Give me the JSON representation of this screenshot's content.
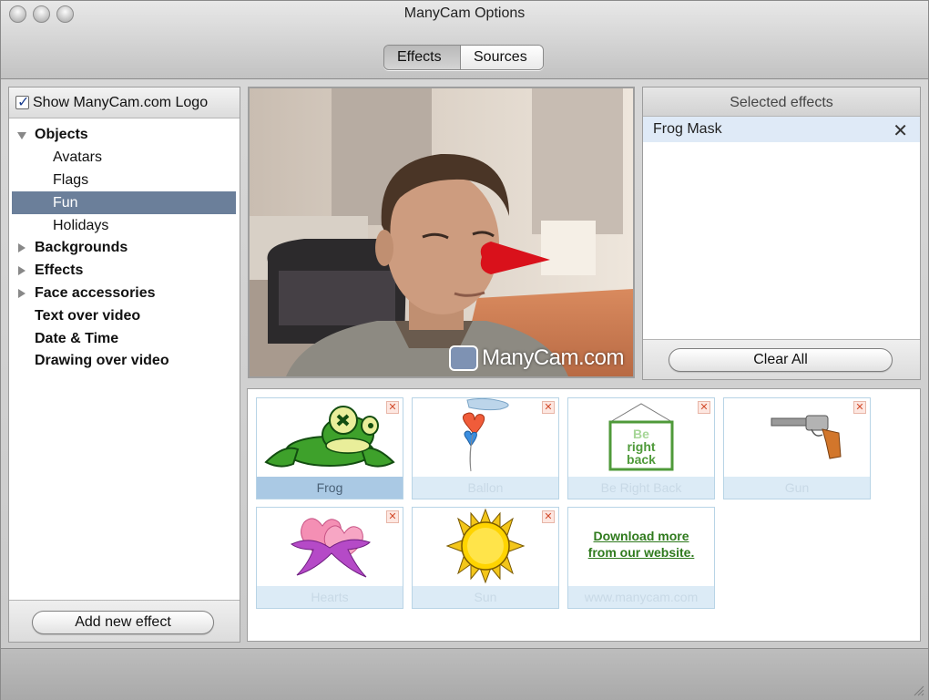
{
  "window": {
    "title": "ManyCam Options"
  },
  "tabs": [
    {
      "label": "Effects"
    },
    {
      "label": "Sources"
    }
  ],
  "left_panel": {
    "show_logo_label": "Show ManyCam.com Logo",
    "show_logo_checked": true,
    "tree": [
      {
        "label": "Objects",
        "level": 0,
        "expanded": true
      },
      {
        "label": "Avatars",
        "level": 1
      },
      {
        "label": "Flags",
        "level": 1
      },
      {
        "label": "Fun",
        "level": 1,
        "selected": true
      },
      {
        "label": "Holidays",
        "level": 1
      },
      {
        "label": "Backgrounds",
        "level": 0,
        "expanded": false
      },
      {
        "label": "Effects",
        "level": 0,
        "expanded": false
      },
      {
        "label": "Face accessories",
        "level": 0,
        "expanded": false
      },
      {
        "label": "Text over video",
        "level": 0
      },
      {
        "label": "Date & Time",
        "level": 0
      },
      {
        "label": "Drawing over video",
        "level": 0
      }
    ],
    "add_button": "Add new effect"
  },
  "preview": {
    "watermark": "ManyCam.com"
  },
  "selected_effects": {
    "header": "Selected effects",
    "items": [
      {
        "label": "Frog Mask"
      }
    ],
    "clear_button": "Clear All"
  },
  "effects_grid": {
    "tiles": [
      {
        "caption": "Frog",
        "icon": "frog-icon",
        "active": true
      },
      {
        "caption": "Ballon",
        "icon": "balloon-icon"
      },
      {
        "caption": "Be Right Back",
        "icon": "be-right-back-sign-icon",
        "sign_text": [
          "Be",
          "right",
          "back"
        ]
      },
      {
        "caption": "Gun",
        "icon": "gun-icon"
      },
      {
        "caption": "Hearts",
        "icon": "hearts-icon"
      },
      {
        "caption": "Sun",
        "icon": "sun-icon"
      },
      {
        "caption": "www.manycam.com",
        "link_lines": [
          "Download more",
          "from our website."
        ]
      }
    ]
  },
  "colors": {
    "selection": "#6b7f9a",
    "active_caption": "#aac9e4",
    "link_green": "#2f7a1d"
  }
}
